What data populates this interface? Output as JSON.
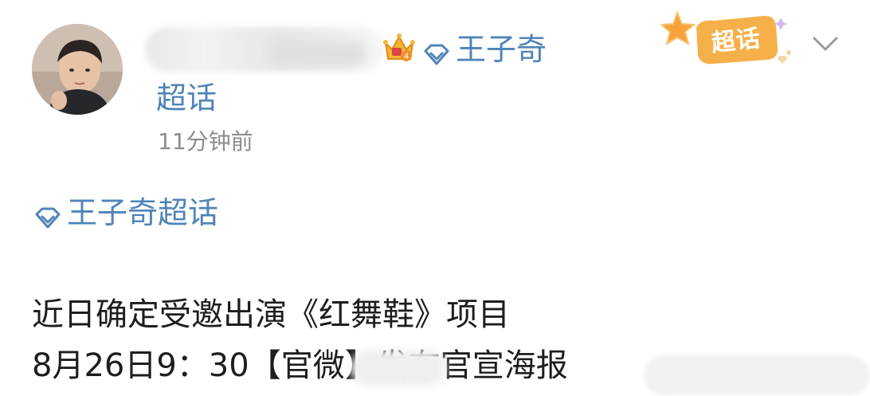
{
  "post": {
    "topic_name_part1": "王子奇",
    "topic_name_part2": "超话",
    "timestamp": "11分钟前",
    "topic_tag": "王子奇超话",
    "badge_label": "超话",
    "body_line1": "近日确定受邀出演《红舞鞋》项目",
    "body_line2": "8月26日9：30【官微】发布官宣海报"
  },
  "icons": {
    "avatar": "avatar-photo",
    "crown": "crown-level-icon",
    "diamond": "diamond-supertopic-icon",
    "badge": "supertopic-star-badge",
    "chevron": "chevron-down-icon"
  },
  "colors": {
    "link_blue": "#4f84b8",
    "timestamp_gray": "#8c8c8c",
    "body_text": "#1e1e1e",
    "badge_orange": "#f6b04a"
  }
}
